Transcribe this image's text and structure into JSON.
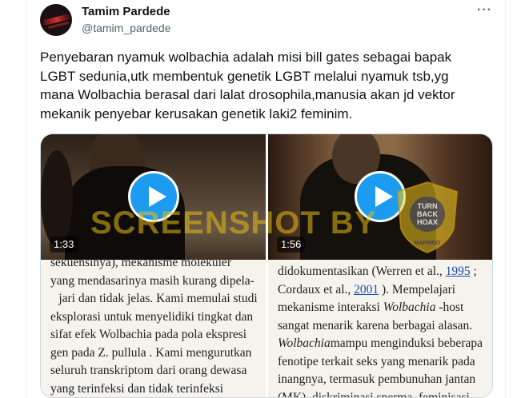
{
  "author": {
    "name": "Tamim Pardede",
    "handle": "@tamim_pardede"
  },
  "more_label": "···",
  "tweet": {
    "lines": [
      "Penyebaran nyamuk wolbachia adalah misi bill gates sebagai bapak",
      "LGBT sedunia,utk membentuk genetik LGBT melalui nyamuk tsb,yg",
      "mana Wolbachia berasal dari lalat drosophila,manusia akan jd vektor",
      "mekanik penyebar kerusakan genetik laki2 feminim."
    ]
  },
  "media": {
    "video1": {
      "duration": "1:33"
    },
    "video2": {
      "duration": "1:56"
    },
    "watermark": "SCREENSHOT BY",
    "badge": {
      "ring_text": "MASYARAKAT ANTI FITNAH INDONESIA",
      "bottom_text": "MAFINDO",
      "center": [
        "TURN",
        "BACK",
        "HOAX"
      ]
    },
    "doc_left": [
      "sekuensinya), mekanisme molekuler",
      "yang mendasarinya masih kurang dipela-",
      "jari dan tidak jelas. Kami memulai studi",
      "eksplorasi untuk menyelidiki tingkat dan",
      "sifat efek Wolbachia pada pola ekspresi",
      "gen pada Z. pullula . Kami mengurutkan",
      "seluruh transkriptom dari orang dewasa",
      "yang terinfeksi dan tidak terinfeksi"
    ],
    "doc_right": {
      "l1_pre": "didokumentasikan (Werren et al., ",
      "l1_link": "1995",
      "l1_post": " ;",
      "l2_pre": "Cordaux et al., ",
      "l2_link": "2001",
      "l2_post": " ). Mempelajari",
      "l3_pre": "mekanisme interaksi ",
      "l3_em": "Wolbachia",
      "l3_post": " -host",
      "l4": "sangat menarik karena berbagai alasan.",
      "l5_em": "Wolbachia",
      "l5_post": "mampu menginduksi beberapa",
      "l6": "fenotipe terkait seks yang menarik pada",
      "l7": "inangnya, termasuk pembunuhan jantan",
      "l8": "(MK), diskriminasi sperma, feminisasi"
    }
  },
  "colors": {
    "accent": "#1d9bf0",
    "muted": "#536471",
    "watermark": "#e6be14"
  }
}
